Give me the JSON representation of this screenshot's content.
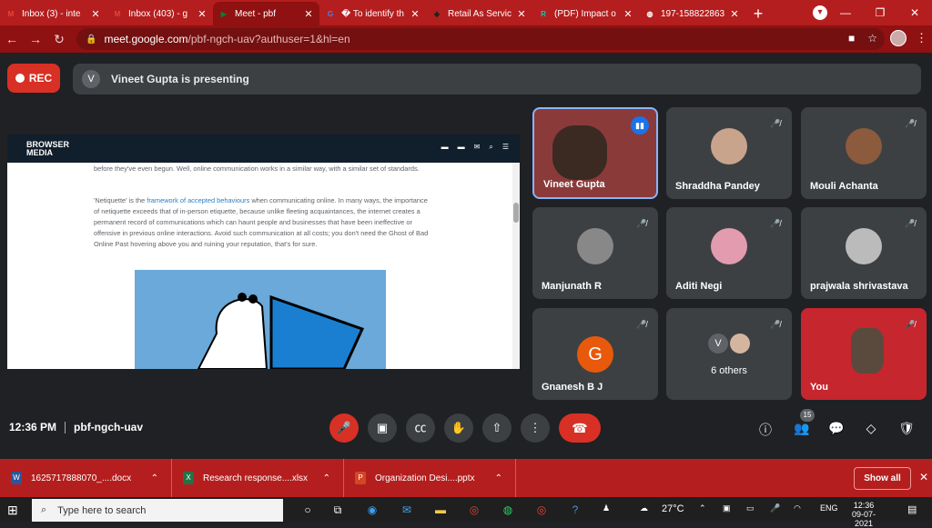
{
  "browser": {
    "tabs": [
      {
        "title": "Inbox (3) - inte",
        "favicon": "gmail-icon",
        "color": "#ea4335",
        "glyph": "M"
      },
      {
        "title": "Inbox (403) - g",
        "favicon": "gmail-icon",
        "color": "#ea4335",
        "glyph": "M"
      },
      {
        "title": "Meet - pbf",
        "favicon": "meet-icon",
        "color": "#00832d",
        "glyph": "▶",
        "active": true
      },
      {
        "title": "� To identify th",
        "favicon": "google-icon",
        "color": "#4285f4",
        "glyph": "G"
      },
      {
        "title": "Retail As Servic",
        "favicon": "site-icon",
        "color": "#222222",
        "glyph": "◆"
      },
      {
        "title": "(PDF) Impact o",
        "favicon": "researchgate-icon",
        "color": "#00ccbb",
        "glyph": "R"
      },
      {
        "title": "197-158822863",
        "favicon": "globe-icon",
        "color": "#ffffff",
        "glyph": "◍"
      }
    ],
    "new_tab": "+",
    "url_host": "meet.google.com",
    "url_path": "/pbf-ngch-uav?authuser=1&hl=en"
  },
  "meet": {
    "rec_label": "REC",
    "presenter_initial": "V",
    "presenting_text": "Vineet Gupta is presenting",
    "shared_page": {
      "logo_line1": "BROWSER",
      "logo_line2": "MEDIA",
      "para1": "before they've even begun. Well, online communication works in a similar way, with a similar set of standards.",
      "para2_a": "'Netiquette' is the ",
      "para2_link": "framework of accepted behaviours",
      "para2_b": " when communicating online. In many ways, the importance of netiquette exceeds that of in-person etiquette, because unlike fleeting acquaintances, the internet creates a permanent record of communications which can haunt people and businesses that have been ineffective or offensive in previous online interactions. Avoid such communication at all costs; you don't need the Ghost of Bad Online Past hovering above you and ruining your reputation, that's for sure."
    },
    "participants": [
      {
        "name": "Vineet Gupta",
        "speaking": true
      },
      {
        "name": "Shraddha Pandey"
      },
      {
        "name": "Mouli Achanta"
      },
      {
        "name": "Manjunath R"
      },
      {
        "name": "Aditi Negi"
      },
      {
        "name": "prajwala shrivastava"
      },
      {
        "name": "Gnanesh B J",
        "initial": "G"
      },
      {
        "name": "6 others",
        "initial": "V"
      },
      {
        "name": "You"
      }
    ],
    "time": "12:36 PM",
    "meeting_code": "pbf-ngch-uav",
    "participant_count": "15"
  },
  "downloads": {
    "items": [
      {
        "name": "1625717888070_....docx",
        "type": "word-icon",
        "color": "#2b579a",
        "glyph": "W"
      },
      {
        "name": "Research response....xlsx",
        "type": "excel-icon",
        "color": "#217346",
        "glyph": "X"
      },
      {
        "name": "Organization Desi....pptx",
        "type": "powerpoint-icon",
        "color": "#d24726",
        "glyph": "P"
      }
    ],
    "show_all": "Show all"
  },
  "taskbar": {
    "search_placeholder": "Type here to search",
    "weather": "27°C",
    "language": "ENG",
    "time": "12:36",
    "date": "09-07-2021"
  }
}
